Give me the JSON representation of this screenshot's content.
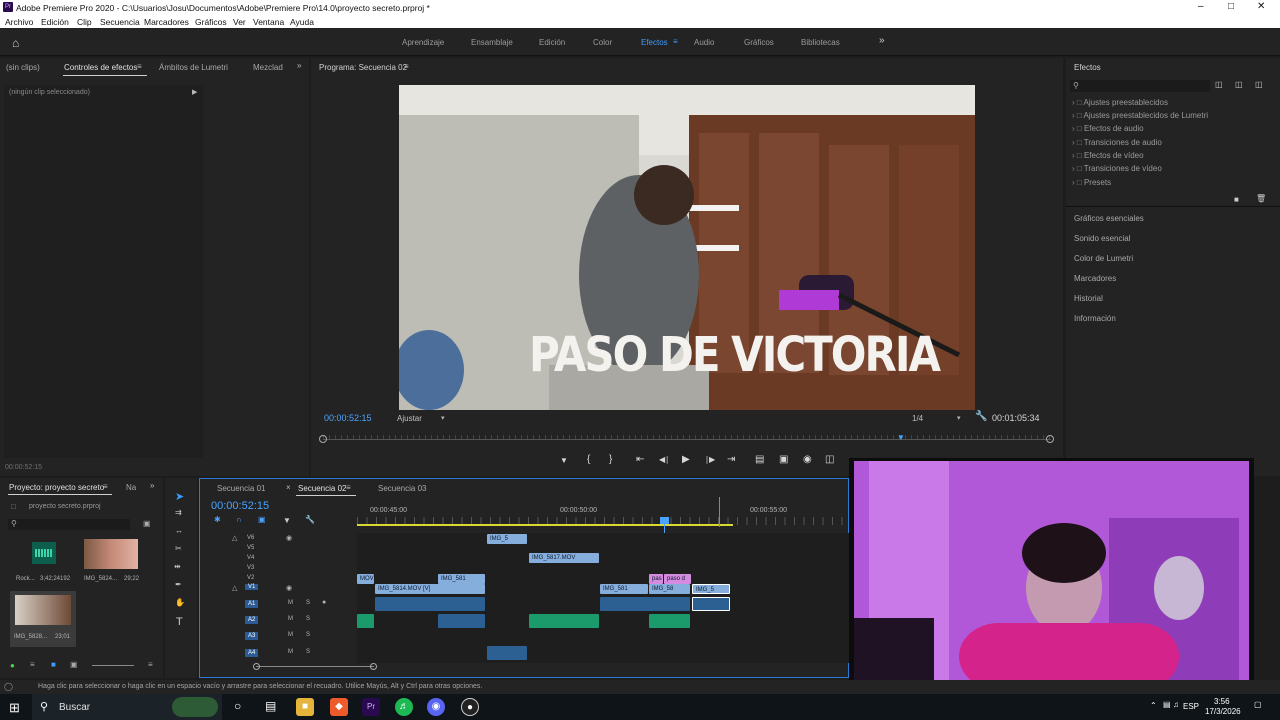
{
  "window": {
    "title": "Adobe Premiere Pro 2020 - C:\\Usuarios\\Josu\\Documentos\\Adobe\\Premiere Pro\\14.0\\proyecto secreto.prproj *",
    "app_icon": "Pr"
  },
  "menu": [
    "Archivo",
    "Edición",
    "Clip",
    "Secuencia",
    "Marcadores",
    "Gráficos",
    "Ver",
    "Ventana",
    "Ayuda"
  ],
  "workspaces": [
    "Aprendizaje",
    "Ensamblaje",
    "Edición",
    "Color",
    "Efectos",
    "Audio",
    "Gráficos",
    "Bibliotecas"
  ],
  "workspace_active": "Efectos",
  "source_panel": {
    "tabs": [
      "(sin clips)",
      "Controles de efectos",
      "Ámbitos de Lumetri",
      "Mezclad"
    ],
    "no_clip": "(ningún clip seleccionado)",
    "timecode": "00:00:52:15"
  },
  "program_monitor": {
    "title": "Programa: Secuencia 02",
    "overlay_text": "PASO DE VICTORIA",
    "timecode": "00:00:52:15",
    "fit": "Ajustar",
    "quality": "1/4",
    "duration": "00:01:05:34"
  },
  "effects_panel": {
    "title": "Efectos",
    "items": [
      "Ajustes preestablecidos",
      "Ajustes preestablecidos de Lumetri",
      "Efectos de audio",
      "Transiciones de audio",
      "Efectos de vídeo",
      "Transiciones de vídeo",
      "Presets"
    ],
    "sections": [
      "Gráficos esenciales",
      "Sonido esencial",
      "Color de Lumetri",
      "Marcadores",
      "Historial",
      "Información"
    ]
  },
  "project_panel": {
    "tabs": [
      "Proyecto: proyecto secreto",
      "Na"
    ],
    "file": "proyecto secreto.prproj",
    "items": [
      {
        "name": "Rock...",
        "duration": "3;42;24192"
      },
      {
        "name": "IMG_5824...",
        "duration": "29;22"
      },
      {
        "name": "IMG_5828...",
        "duration": "23;01"
      }
    ]
  },
  "timeline": {
    "tabs": [
      "Secuencia 01",
      "Secuencia 02",
      "Secuencia 03"
    ],
    "active_tab": "Secuencia 02",
    "timecode": "00:00:52:15",
    "ruler": [
      "00:00:45:00",
      "00:00:50:00",
      "00:00:55:00"
    ],
    "video_tracks": [
      "V6",
      "V5",
      "V4",
      "V3",
      "V2",
      "V1"
    ],
    "audio_tracks": [
      "A1",
      "A2",
      "A3",
      "A4"
    ],
    "clips": {
      "v6": "IMG_5",
      "v5": "IMG_5817.MOV",
      "v2a": "IMG_581",
      "v2b": "pas",
      "v2c": "paso d",
      "v1a": "IMG_5814.MOV [V]",
      "v1b": "MOV",
      "v1c": "IMG_581",
      "v1d": "IMG_58",
      "v1e": "IMG_5"
    },
    "track_labels": {
      "mute": "M",
      "solo": "S"
    }
  },
  "status_bar": "Haga clic para seleccionar o haga clic en un espacio vacío y arrastre para seleccionar el recuadro. Utilice Mayús, Alt y Ctrl para otras opciones.",
  "taskbar": {
    "search": "Buscar",
    "lang": "ESP",
    "time": "3:56",
    "date": "17/3/2026"
  },
  "colors": {
    "accent_blue": "#2d8ceb",
    "premiere_purple": "#2a0a4e",
    "webcam_bg": "#b05ad6"
  }
}
